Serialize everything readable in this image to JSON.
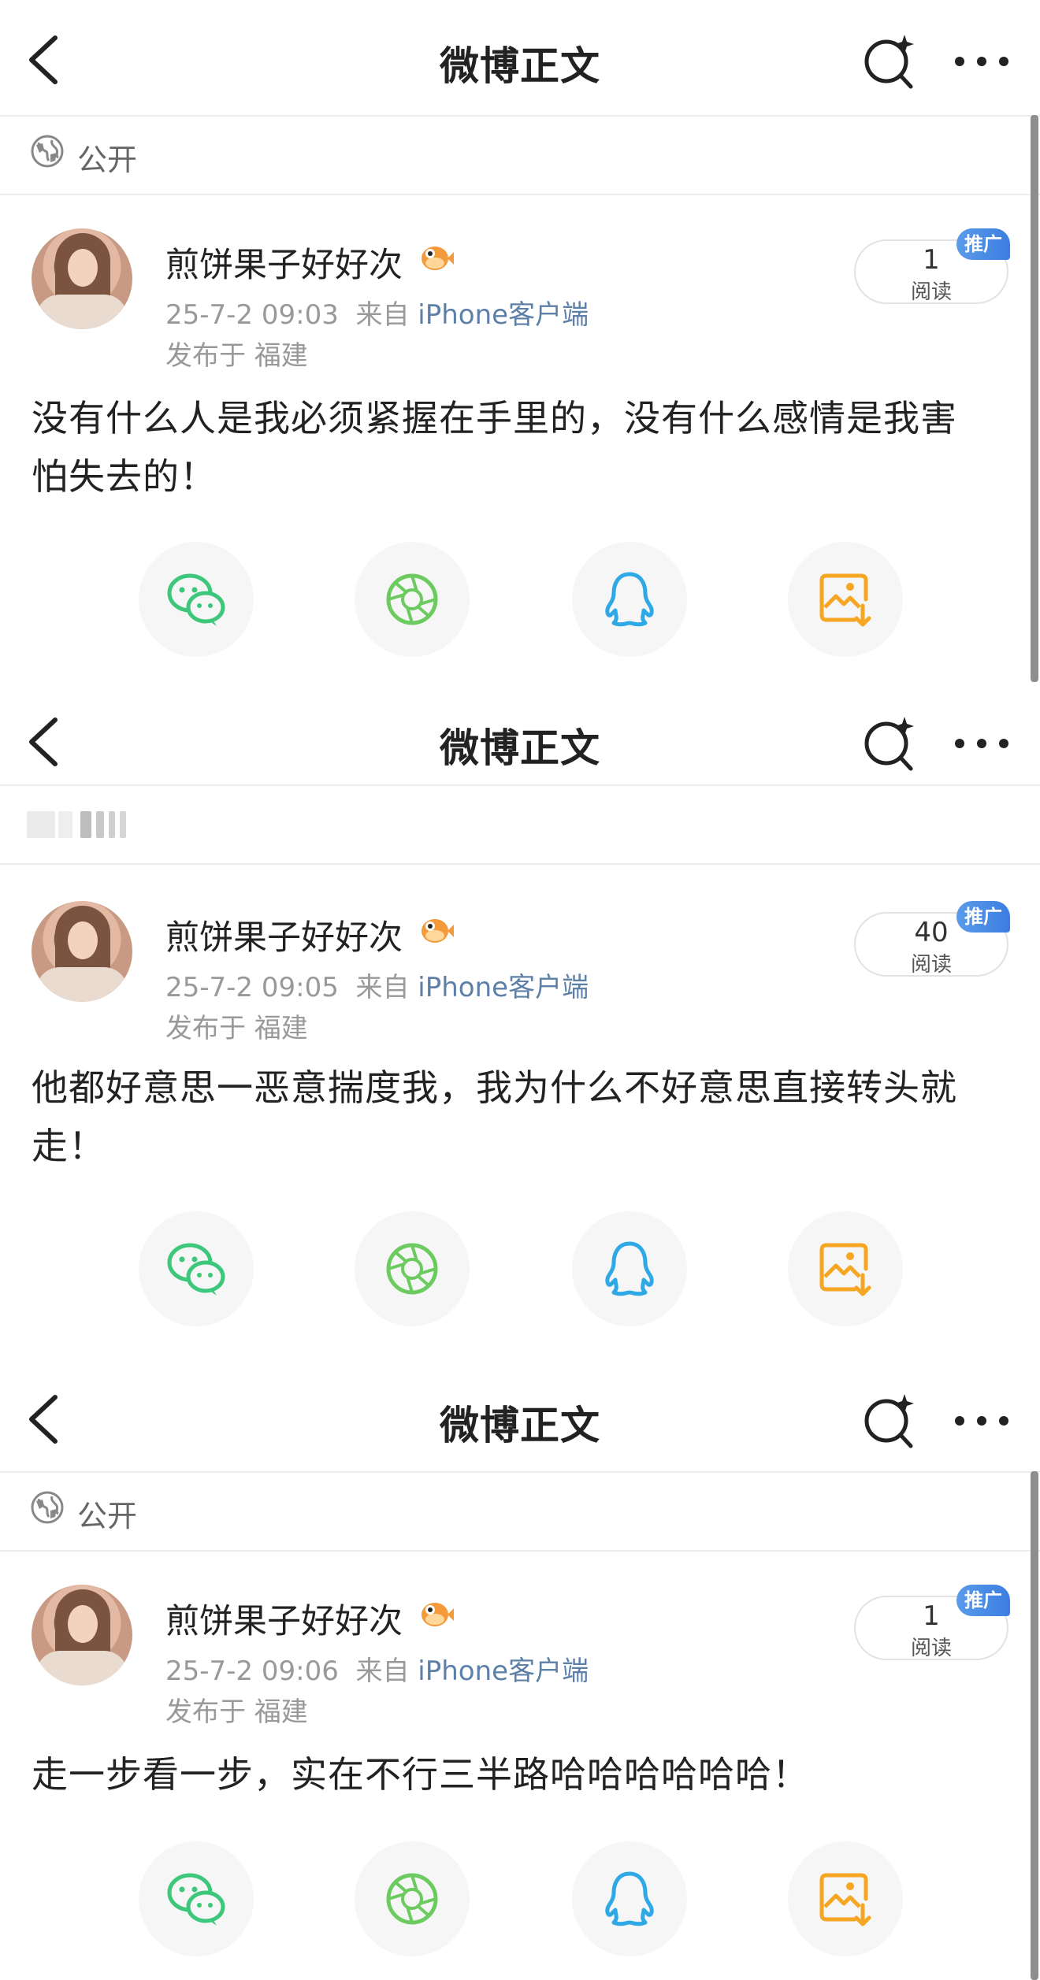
{
  "posts": [
    {
      "nav": {
        "title": "微博正文"
      },
      "visibility": {
        "label": "公开",
        "blurred": false
      },
      "author": {
        "name": "煎饼果子好好次",
        "avatar_icon": "avatar-photo",
        "badge_icon": "pufferfish-badge-icon"
      },
      "meta": {
        "time": "25-7-2 09:03",
        "from_prefix": "来自",
        "source": "iPhone客户端",
        "location": "发布于 福建"
      },
      "reads": {
        "count": "1",
        "label": "阅读",
        "promo": "推广"
      },
      "content": "没有什么人是我必须紧握在手里的，没有什么感情是我害怕失去的！"
    },
    {
      "nav": {
        "title": "微博正文"
      },
      "visibility": {
        "label": "",
        "blurred": true
      },
      "author": {
        "name": "煎饼果子好好次",
        "avatar_icon": "avatar-photo",
        "badge_icon": "pufferfish-badge-icon"
      },
      "meta": {
        "time": "25-7-2 09:05",
        "from_prefix": "来自",
        "source": "iPhone客户端",
        "location": "发布于 福建"
      },
      "reads": {
        "count": "40",
        "label": "阅读",
        "promo": "推广"
      },
      "content": "他都好意思一恶意揣度我，我为什么不好意思直接转头就走！"
    },
    {
      "nav": {
        "title": "微博正文"
      },
      "visibility": {
        "label": "公开",
        "blurred": false
      },
      "author": {
        "name": "煎饼果子好好次",
        "avatar_icon": "avatar-photo",
        "badge_icon": "pufferfish-badge-icon"
      },
      "meta": {
        "time": "25-7-2 09:06",
        "from_prefix": "来自",
        "source": "iPhone客户端",
        "location": "发布于 福建"
      },
      "reads": {
        "count": "1",
        "label": "阅读",
        "promo": "推广"
      },
      "content": "走一步看一步，实在不行三半路哈哈哈哈哈哈！"
    }
  ],
  "share_targets": [
    {
      "name": "wechat-icon",
      "color": "#3cc77a"
    },
    {
      "name": "moments-icon",
      "color": "#6ccb5f"
    },
    {
      "name": "qq-icon",
      "color": "#2fa9e6"
    },
    {
      "name": "save-image-icon",
      "color": "#f5a623"
    }
  ],
  "colors": {
    "link": "#5d80a8",
    "promo": "#3c7ee0",
    "meta": "#999999"
  }
}
